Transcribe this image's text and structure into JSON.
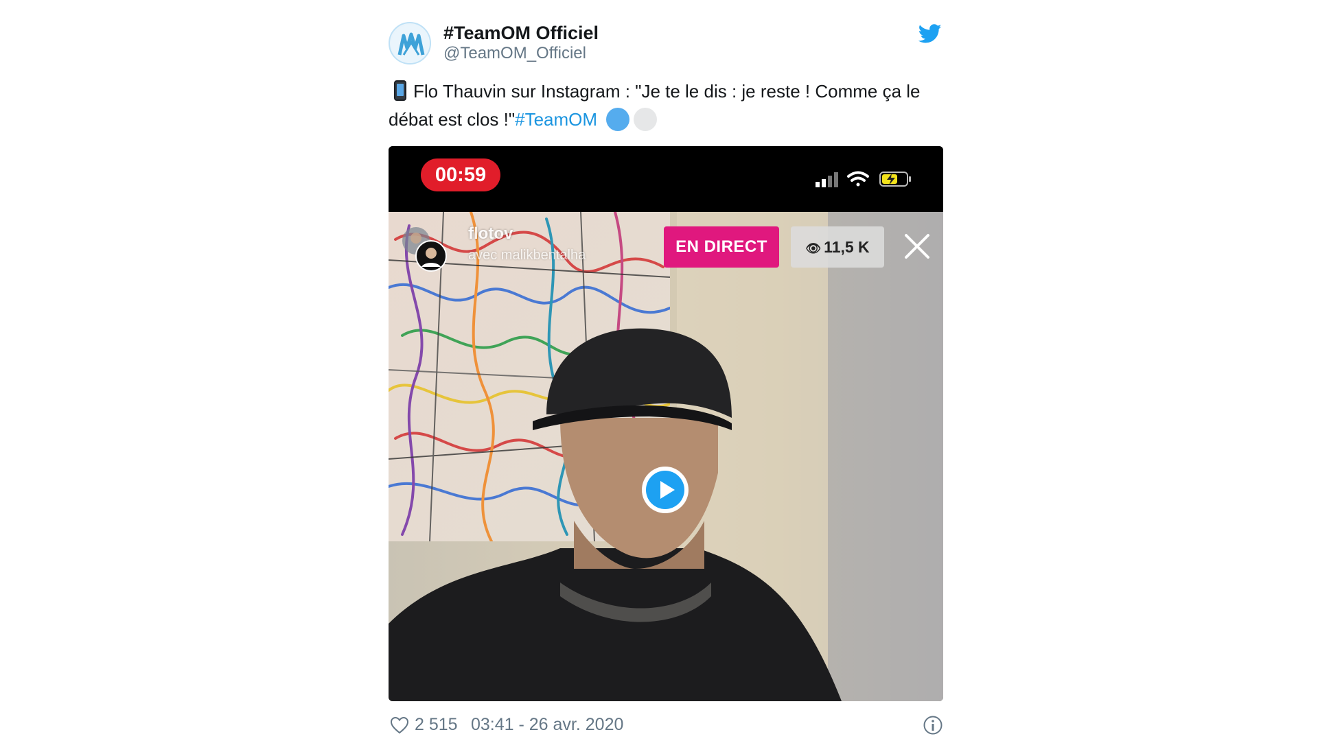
{
  "tweet": {
    "display_name": "#TeamOM Officiel",
    "handle": "@TeamOM_Officiel",
    "text_before": "Flo Thauvin sur Instagram : \"Je te le dis : je reste ! Comme ça le débat est clos !\"",
    "hashtag": "#TeamOM",
    "brand_color": "#1da1f2",
    "hashtag_color": "#1b95e0",
    "dot_colors": [
      "#55acee",
      "#e6e7e8"
    ],
    "icons": {
      "avatar": "om-logo",
      "bird": "twitter-bird-icon",
      "phone": "mobile-phone-emoji",
      "heart": "heart-icon",
      "info": "info-icon"
    }
  },
  "media": {
    "timer": "00:59",
    "ig_username": "flotov",
    "ig_with": "avec malikbentalha",
    "live_label": "EN DIRECT",
    "viewers": "11,5 K",
    "live_color": "#e0187e",
    "timer_color": "#e11d2a"
  },
  "footer": {
    "likes": "2 515",
    "timestamp": "03:41 - 26 avr. 2020"
  }
}
